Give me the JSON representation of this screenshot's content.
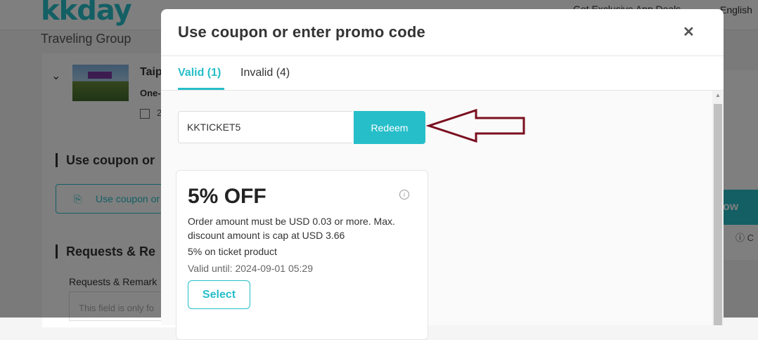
{
  "background": {
    "logo": "kkday",
    "app_deals": "Get Exclusive App Deals",
    "language": "English",
    "group_title": "Traveling Group",
    "product_name": "Taip",
    "product_sub": "One-",
    "product_date": "2",
    "coupon_section_title": "Use coupon or",
    "coupon_button_label": "Use coupon or",
    "requests_section_title": "Requests & Re",
    "requests_label": "Requests & Remark",
    "requests_placeholder": "This field is only fo",
    "book_button": "ow",
    "help_text": "C"
  },
  "modal": {
    "title": "Use coupon or enter promo code",
    "close_label": "✕",
    "tabs": [
      {
        "label": "Valid (1)",
        "active": true
      },
      {
        "label": "Invalid (4)",
        "active": false
      }
    ],
    "promo_input_value": "KKTICKET5",
    "redeem_label": "Redeem",
    "coupons": [
      {
        "title": "5% OFF",
        "description": "Order amount must be USD 0.03 or more. Max. discount amount is cap at USD 3.66",
        "type": "5% on ticket product",
        "valid_until": "Valid until: 2024-09-01 05:29",
        "select_label": "Select"
      }
    ]
  },
  "colors": {
    "accent": "#26bec9",
    "arrow": "#7a0f1f",
    "overlay": "rgba(0,0,0,0.5)"
  }
}
